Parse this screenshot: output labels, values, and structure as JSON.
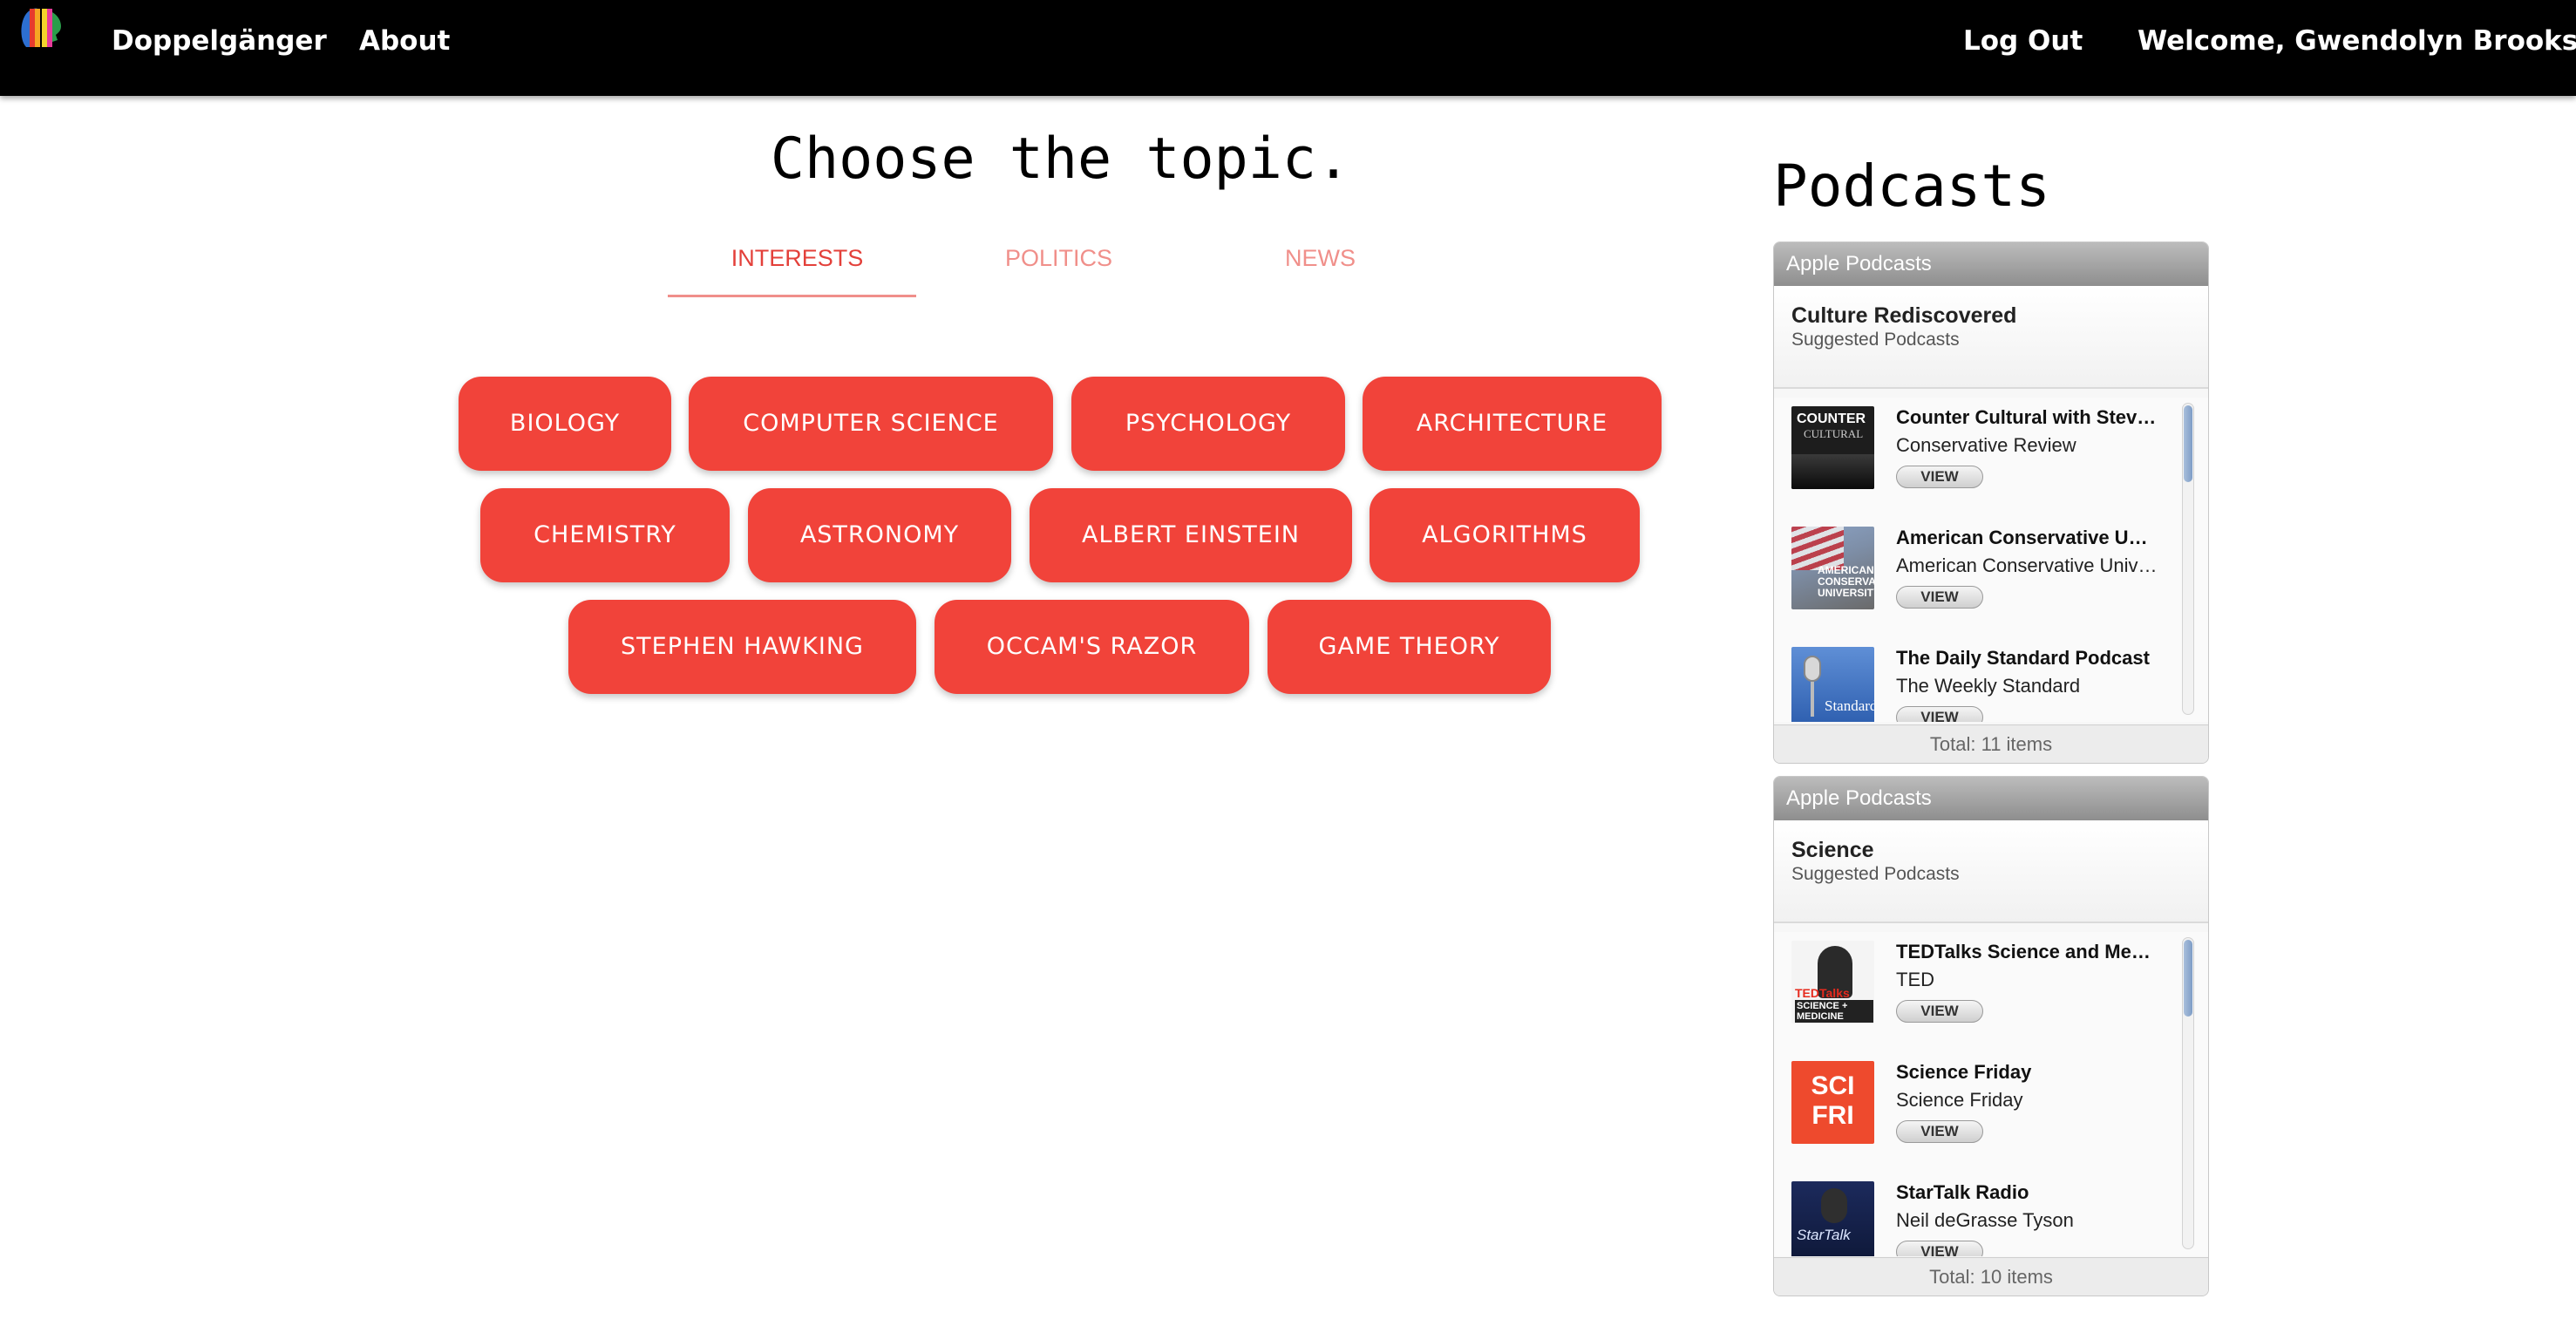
{
  "navbar": {
    "brand": "Doppelgänger",
    "about": "About",
    "logout": "Log Out",
    "welcome": "Welcome, Gwendolyn Brooks"
  },
  "main": {
    "title": "Choose the topic.",
    "tabs": [
      "INTERESTS",
      "POLITICS",
      "NEWS"
    ],
    "active_tab": "INTERESTS",
    "topics": [
      "BIOLOGY",
      "COMPUTER SCIENCE",
      "PSYCHOLOGY",
      "ARCHITECTURE",
      "CHEMISTRY",
      "ASTRONOMY",
      "ALBERT EINSTEIN",
      "ALGORITHMS",
      "STEPHEN HAWKING",
      "OCCAM'S RAZOR",
      "GAME THEORY"
    ]
  },
  "sidebar": {
    "heading": "Podcasts",
    "widgets": [
      {
        "header": "Apple Podcasts",
        "title": "Culture Rediscovered",
        "subtitle": "Suggested Podcasts",
        "items": [
          {
            "title": "Counter Cultural with Steve Deace",
            "author": "Conservative Review",
            "view": "VIEW",
            "thumb_text": "COUNTER",
            "thumb_text2": "CULTURAL"
          },
          {
            "title": "American Conservative University",
            "author": "American Conservative University",
            "view": "VIEW",
            "thumb_text": "AMERICAN CONSERVATIVE UNIVERSITY"
          },
          {
            "title": "The Daily Standard Podcast",
            "author": "The Weekly Standard",
            "view": "VIEW",
            "thumb_text": "Standard"
          }
        ],
        "footer": "Total: 11 items"
      },
      {
        "header": "Apple Podcasts",
        "title": "Science",
        "subtitle": "Suggested Podcasts",
        "items": [
          {
            "title": "TEDTalks Science and Medicine",
            "author": "TED",
            "view": "VIEW",
            "thumb_text": "TEDTalks",
            "thumb_text2": "SCIENCE + MEDICINE"
          },
          {
            "title": "Science Friday",
            "author": "Science Friday",
            "view": "VIEW",
            "thumb_text": "SCI FRI"
          },
          {
            "title": "StarTalk Radio",
            "author": "Neil deGrasse Tyson",
            "view": "VIEW",
            "thumb_text": "StarTalk"
          }
        ],
        "footer": "Total: 10 items"
      }
    ]
  },
  "colors": {
    "accent": "#f1433a",
    "active_tab": "#e3403a",
    "inactive_tab": "#f08f8a",
    "navbar_bg": "#000000"
  },
  "icons": {
    "logo": "doppelganger-rainbow-heads-logo",
    "scroll": "scrollbar-thumb"
  }
}
